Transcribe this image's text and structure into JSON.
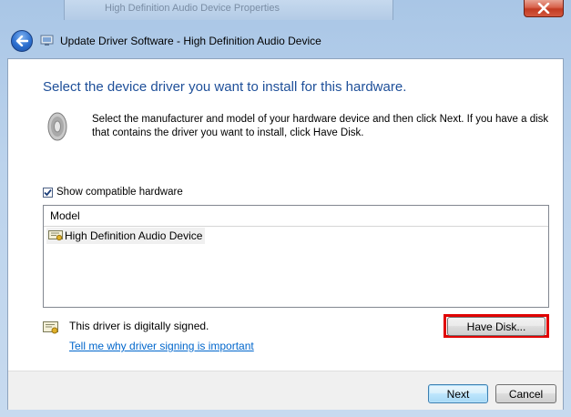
{
  "window": {
    "background_title": "High Definition Audio Device Properties",
    "title": "Update Driver Software - High Definition Audio Device"
  },
  "content": {
    "heading": "Select the device driver you want to install for this hardware.",
    "instructions": "Select the manufacturer and model of your hardware device and then click Next. If you have a disk that contains the driver you want to install, click Have Disk.",
    "show_compatible_label": "Show compatible hardware",
    "show_compatible_checked": true
  },
  "list": {
    "column_header": "Model",
    "items": [
      {
        "label": "High Definition Audio Device",
        "selected": true
      }
    ]
  },
  "signing": {
    "status_text": "This driver is digitally signed.",
    "link_text": "Tell me why driver signing is important"
  },
  "buttons": {
    "have_disk": "Have Disk...",
    "next": "Next",
    "cancel": "Cancel"
  },
  "colors": {
    "heading": "#1e4f99",
    "link": "#0066cc",
    "highlight_box": "#e00000"
  },
  "icons": {
    "back": "back-arrow-icon",
    "title": "driver-wizard-icon",
    "speaker": "speaker-icon",
    "list_item": "driver-certificate-icon",
    "signed": "certificate-icon",
    "close": "close-icon"
  }
}
